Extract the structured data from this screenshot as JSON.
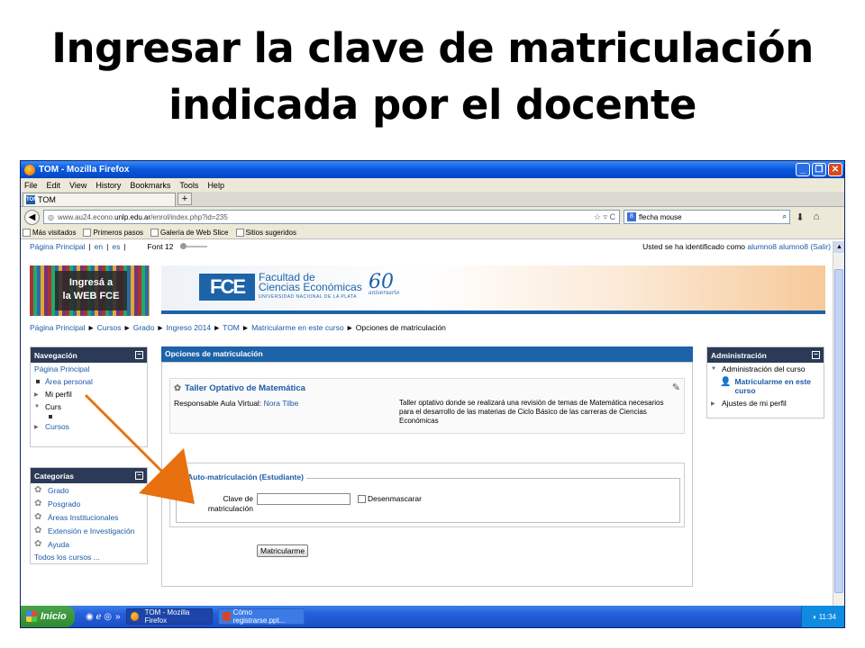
{
  "slide": {
    "title_line1": "Ingresar la clave de matriculación",
    "title_line2": "indicada por el docente"
  },
  "window": {
    "title": "TOM - Mozilla Firefox",
    "minimize": "_",
    "maximize": "❐",
    "close": "✕"
  },
  "menu": [
    "File",
    "Edit",
    "View",
    "History",
    "Bookmarks",
    "Tools",
    "Help"
  ],
  "tab": {
    "label": "TOM",
    "favicon": "TOM",
    "new_tab": "+"
  },
  "nav": {
    "url_domain": "www.au24.econo.",
    "url_bold": "unlp.edu.ar",
    "url_path": "/enrol/index.php?id=235",
    "url_icons": "☆ ▿ C",
    "search_value": "flecha mouse",
    "search_engine": "8"
  },
  "bookmarks": [
    "Más visitados",
    "Primeros pasos",
    "Galería de Web Slice",
    "Sitios sugeridos"
  ],
  "topbar": {
    "home": "Página Principal",
    "sep": "|",
    "lang_en": "en",
    "lang_es": "es",
    "font": "Font 12",
    "login_prefix": "Usted se ha identificado como ",
    "user": "alumno8 alumno8",
    "logout": "(Salir)"
  },
  "banner": {
    "ingresa_line1": "Ingresá a",
    "ingresa_line2": "la WEB FCE",
    "fce_mark": "FCE",
    "fce_line1": "Facultad de",
    "fce_line2": "Ciencias Económicas",
    "fce_sub": "UNIVERSIDAD NACIONAL DE LA PLATA",
    "anniv_number": "60",
    "anniv_word": "aniversario"
  },
  "breadcrumb": {
    "items": [
      "Página Principal",
      "Cursos",
      "Grado",
      "Ingreso 2014",
      "TOM",
      "Matricularme en este curso"
    ],
    "current": "Opciones de matriculación",
    "separator": "►"
  },
  "navegacion": {
    "title": "Navegación",
    "toggle": "−",
    "home": "Página Principal",
    "area_personal": "Área personal",
    "mi_perfil": "Mi perfil",
    "cursos_partial": "Curs",
    "cursos": "Cursos"
  },
  "categorias": {
    "title": "Categorías",
    "toggle": "−",
    "items": [
      "Grado",
      "Posgrado",
      "Áreas Institucionales",
      "Extensión e Investigación",
      "Ayuda"
    ],
    "all": "Todos los cursos ..."
  },
  "administracion": {
    "title": "Administración",
    "toggle": "−",
    "course_admin": "Administración del curso",
    "enrol_me_line1": "Matricularme en este",
    "enrol_me_line2": "curso",
    "profile_settings": "Ajustes de mi perfil"
  },
  "main": {
    "header": "Opciones de matriculación",
    "course_title": "Taller Optativo de Matemática",
    "resp_label": "Responsable Aula Virtual: ",
    "resp_name": "Nora Tilbe",
    "description": "Taller optativo donde se realizará una revisión de temas de Matemática necesarios para el desarrollo de las materias de Ciclo Básico de las carreras de Ciencias Económicas",
    "legend": "Auto-matriculación (Estudiante)",
    "key_label_line1": "Clave de",
    "key_label_line2": "matriculación",
    "key_value": "",
    "unmask": "Desenmascarar",
    "submit": "Matricularme"
  },
  "taskbar": {
    "start": "Inicio",
    "quick_icons": "◉ ℯ ◎",
    "more": "»",
    "task1": "TOM - Mozilla Firefox",
    "task2": "Cómo registrarse.ppt...",
    "time": "11:34"
  },
  "colors": {
    "arrow": "#e8700e",
    "accent": "#1d63a8",
    "block_head": "#2b3a56"
  }
}
